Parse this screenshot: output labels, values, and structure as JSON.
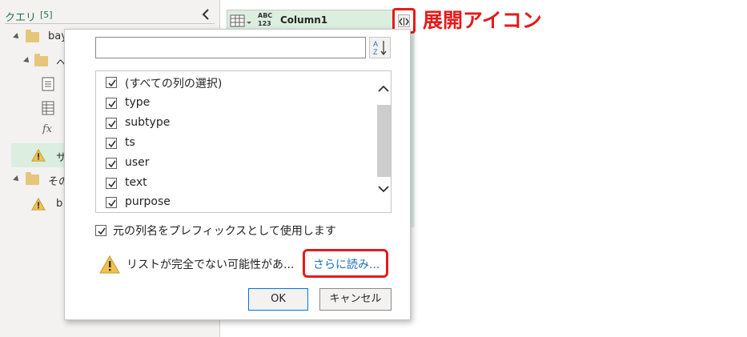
{
  "query_pane": {
    "title": "クエリ",
    "count": "[5]",
    "items": [
      {
        "label": "bay",
        "kind": "folder"
      },
      {
        "label": "ヘ",
        "kind": "folder"
      },
      {
        "label": "",
        "kind": "table"
      },
      {
        "label": "",
        "kind": "grid"
      },
      {
        "label": "fx",
        "kind": "function"
      },
      {
        "label": "サ",
        "kind": "warning"
      },
      {
        "label": "その",
        "kind": "folder"
      },
      {
        "label": "b",
        "kind": "warning"
      }
    ]
  },
  "grid": {
    "type_badge_top": "ABC",
    "type_badge_bottom": "123",
    "column_name": "Column1"
  },
  "annotations": {
    "expand_label": "展開アイコン"
  },
  "popup": {
    "search_value": "",
    "search_placeholder": "",
    "columns": [
      {
        "label": "(すべての列の選択)",
        "checked": true
      },
      {
        "label": "type",
        "checked": true
      },
      {
        "label": "subtype",
        "checked": true
      },
      {
        "label": "ts",
        "checked": true
      },
      {
        "label": "user",
        "checked": true
      },
      {
        "label": "text",
        "checked": true
      },
      {
        "label": "purpose",
        "checked": true
      }
    ],
    "prefix_label": "元の列名をプレフィックスとして使用します",
    "prefix_checked": true,
    "warning_text": "リストが完全でない可能性があ...",
    "more_link": "さらに読み...",
    "ok_label": "OK",
    "cancel_label": "キャンセル"
  },
  "colors": {
    "accent_green": "#217346",
    "highlight_red": "#e41b1b",
    "link_blue": "#1f6fbf"
  }
}
